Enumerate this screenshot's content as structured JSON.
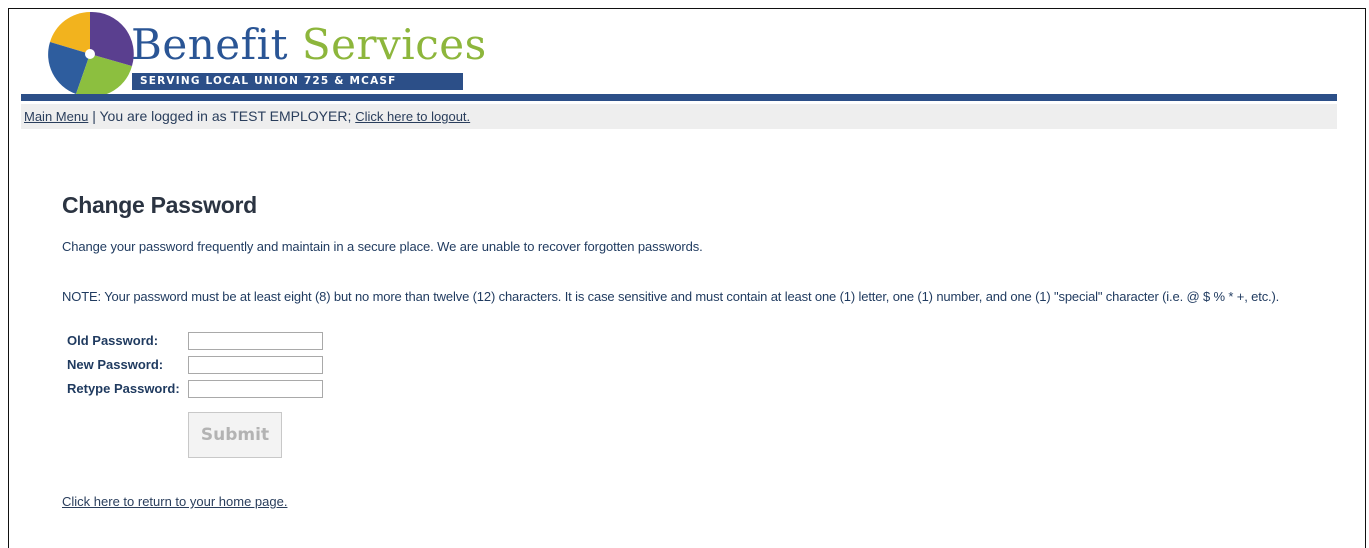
{
  "brand": {
    "name_part1": "Benefit",
    "name_part2": "Services",
    "tagline": "SERVING LOCAL UNION 725 & MCASF"
  },
  "status_bar": {
    "main_menu_link": "Main Menu",
    "separator": " | You are logged in as TEST EMPLOYER; ",
    "logout_link": "Click here to logout."
  },
  "page": {
    "title": "Change Password",
    "intro": "Change your password frequently and maintain in a secure place.  We are unable to recover forgotten passwords.",
    "note": "NOTE: Your password must be at least eight (8) but no more than twelve (12) characters. It is case sensitive and must contain at least one (1) letter, one (1) number, and one (1) \"special\" character (i.e. @ $ % * +, etc.)."
  },
  "form": {
    "old_password_label": "Old Password:",
    "old_password_value": "",
    "new_password_label": "New Password:",
    "new_password_value": "",
    "retype_password_label": "Retype Password:",
    "retype_password_value": "",
    "submit_label": "Submit"
  },
  "home_link": "Click here to return to your home page.",
  "colors": {
    "brand_blue": "#2c4f88",
    "brand_green": "#8db63c",
    "status_bar_bg": "#eeeeee"
  }
}
